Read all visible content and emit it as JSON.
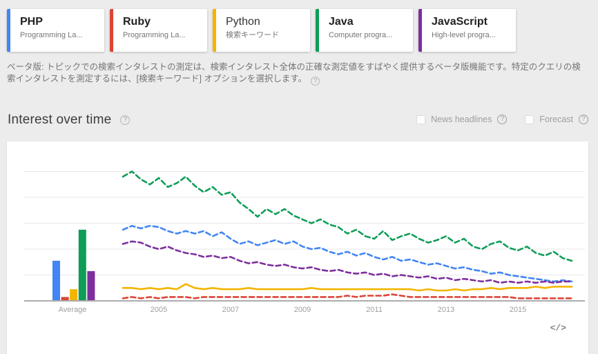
{
  "comparison_cards": [
    {
      "title": "PHP",
      "subtitle": "Programming La...",
      "color": "#4285F4",
      "type": "topic"
    },
    {
      "title": "Ruby",
      "subtitle": "Programming La...",
      "color": "#DB4437",
      "type": "topic"
    },
    {
      "title": "Python",
      "subtitle": "検索キーワード",
      "color": "#F4B400",
      "type": "keyword"
    },
    {
      "title": "Java",
      "subtitle": "Computer progra...",
      "color": "#0F9D58",
      "type": "topic"
    },
    {
      "title": "JavaScript",
      "subtitle": "High-level progra...",
      "color": "#7D2F9E",
      "type": "topic"
    }
  ],
  "beta_notice": {
    "text": "ベータ版: トピックでの検索インタレストの測定は、検索インタレスト全体の正確な測定値をすばやく提供するベータ版機能です。特定のクエリの検索インタレストを測定するには、[検索キーワード] オプションを選択します。",
    "help_icon": "?"
  },
  "section": {
    "title": "Interest over time",
    "help_icon": "?"
  },
  "controls": [
    {
      "label": "News headlines",
      "help_icon": "?",
      "checked": false
    },
    {
      "label": "Forecast",
      "help_icon": "?",
      "checked": false
    }
  ],
  "embed_icon": "</>",
  "colors": {
    "page_background": "#ececec",
    "card_background": "#ffffff",
    "axis_line": "#ababab",
    "gridline": "#e7e7e7",
    "axis_label": "#9e9e9e"
  },
  "chart_data": {
    "type": "line",
    "title": "Interest over time",
    "x_axis": {
      "range": [
        2004,
        2016.5
      ],
      "ticks": [
        "2005",
        "2007",
        "2009",
        "2011",
        "2013",
        "2015"
      ],
      "tick_years": [
        2005,
        2007,
        2009,
        2011,
        2013,
        2015
      ],
      "average_label": "Average"
    },
    "y_axis": {
      "range": [
        0,
        100
      ],
      "gridlines": [
        20,
        40,
        60,
        80,
        100
      ],
      "tick_labels_visible": false
    },
    "legend_visible": false,
    "averages": [
      {
        "name": "PHP",
        "value": 31,
        "color": "#4285F4"
      },
      {
        "name": "Ruby",
        "value": 3,
        "color": "#DB4437"
      },
      {
        "name": "Python",
        "value": 9,
        "color": "#F4B400"
      },
      {
        "name": "Java",
        "value": 55,
        "color": "#0F9D58"
      },
      {
        "name": "JavaScript",
        "value": 23,
        "color": "#7D2F9E"
      }
    ],
    "x_start": 2004.0,
    "x_step": 0.25,
    "series": [
      {
        "name": "Java",
        "color": "#0F9D58",
        "dashed": true,
        "values": [
          96,
          100,
          94,
          90,
          95,
          88,
          91,
          96,
          89,
          84,
          88,
          82,
          84,
          76,
          71,
          65,
          71,
          67,
          71,
          66,
          63,
          60,
          63,
          59,
          57,
          52,
          55,
          50,
          48,
          54,
          47,
          50,
          52,
          48,
          45,
          47,
          50,
          45,
          48,
          42,
          40,
          44,
          46,
          41,
          39,
          42,
          37,
          35,
          38,
          33,
          31
        ]
      },
      {
        "name": "PHP",
        "color": "#4285F4",
        "dashed": true,
        "values": [
          55,
          58,
          56,
          58,
          57,
          54,
          52,
          54,
          52,
          54,
          50,
          53,
          48,
          44,
          46,
          43,
          45,
          47,
          44,
          46,
          42,
          40,
          41,
          38,
          36,
          38,
          35,
          37,
          34,
          32,
          34,
          31,
          32,
          30,
          28,
          29,
          27,
          25,
          26,
          24,
          23,
          21,
          22,
          20,
          19,
          18,
          17,
          16,
          15,
          16,
          15
        ]
      },
      {
        "name": "JavaScript",
        "color": "#7D2F9E",
        "dashed": true,
        "values": [
          44,
          46,
          45,
          42,
          40,
          42,
          39,
          37,
          36,
          34,
          35,
          33,
          34,
          31,
          29,
          30,
          28,
          27,
          28,
          26,
          25,
          26,
          24,
          23,
          24,
          22,
          21,
          22,
          20,
          21,
          19,
          20,
          19,
          18,
          19,
          17,
          18,
          16,
          17,
          16,
          15,
          16,
          14,
          15,
          14,
          15,
          14,
          15,
          14,
          15,
          15
        ]
      },
      {
        "name": "Python",
        "color": "#F4B400",
        "dashed": false,
        "values": [
          10,
          10,
          9,
          10,
          9,
          10,
          9,
          13,
          10,
          9,
          10,
          9,
          9,
          9,
          10,
          9,
          9,
          9,
          9,
          9,
          9,
          10,
          9,
          9,
          9,
          9,
          9,
          9,
          9,
          9,
          9,
          9,
          9,
          8,
          9,
          8,
          8,
          9,
          8,
          9,
          9,
          10,
          9,
          10,
          10,
          10,
          11,
          10,
          11,
          11,
          11
        ]
      },
      {
        "name": "Ruby",
        "color": "#DB4437",
        "dashed": true,
        "values": [
          2,
          3,
          2,
          3,
          2,
          3,
          3,
          3,
          2,
          3,
          3,
          3,
          3,
          3,
          3,
          3,
          3,
          3,
          3,
          3,
          3,
          3,
          3,
          3,
          3,
          4,
          3,
          4,
          4,
          4,
          5,
          4,
          3,
          3,
          3,
          3,
          3,
          3,
          3,
          3,
          3,
          3,
          3,
          3,
          2,
          2,
          2,
          2,
          2,
          2,
          2
        ]
      }
    ]
  }
}
